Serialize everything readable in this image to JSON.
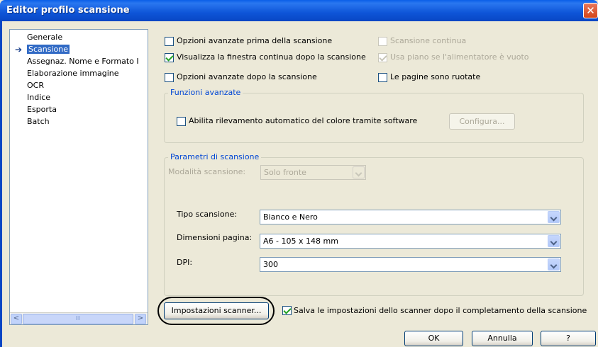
{
  "window": {
    "title": "Editor profilo scansione",
    "close_glyph": "✕"
  },
  "nav": {
    "items": [
      {
        "label": "Generale"
      },
      {
        "label": "Scansione",
        "selected": true
      },
      {
        "label": "Assegnaz. Nome e Formato I"
      },
      {
        "label": "Elaborazione immagine"
      },
      {
        "label": "OCR"
      },
      {
        "label": "Indice"
      },
      {
        "label": "Esporta"
      },
      {
        "label": "Batch"
      }
    ],
    "selected_marker": "➔",
    "scroll_left": "<",
    "scroll_right": ">",
    "scroll_grip": "III"
  },
  "options": {
    "advanced_before": {
      "label": "Opzioni avanzate prima della scansione",
      "checked": false
    },
    "continuous_scan": {
      "label": "Scansione continua",
      "checked": false,
      "disabled": true
    },
    "show_continue": {
      "label": "Visualizza la finestra continua dopo la scansione",
      "checked": true
    },
    "use_flatbed": {
      "label": "Usa piano se l'alimentatore è vuoto",
      "checked": true,
      "disabled": true
    },
    "advanced_after": {
      "label": "Opzioni avanzate dopo la scansione",
      "checked": false
    },
    "pages_rotated": {
      "label": "Le pagine sono ruotate",
      "checked": false
    }
  },
  "advanced": {
    "title": "Funzioni avanzate",
    "auto_color": {
      "label": "Abilita rilevamento automatico del colore tramite software",
      "checked": false
    },
    "configure_button": "Configura..."
  },
  "params": {
    "title": "Parametri di scansione",
    "mode_label": "Modalità scansione:",
    "mode_value": "Solo fronte",
    "type_label": "Tipo scansione:",
    "type_value": "Bianco e Nero",
    "size_label": "Dimensioni pagina:",
    "size_value": "A6 - 105 x 148 mm",
    "dpi_label": "DPI:",
    "dpi_value": "300"
  },
  "footer": {
    "scanner_settings_button": "Impostazioni scanner...",
    "save_settings": {
      "label": "Salva le impostazioni dello scanner dopo il completamento della scansione",
      "checked": true
    },
    "ok": "OK",
    "cancel": "Annulla",
    "help": "?"
  }
}
